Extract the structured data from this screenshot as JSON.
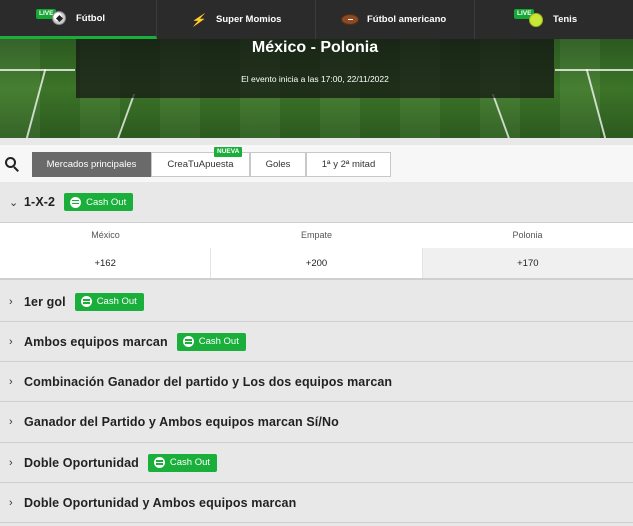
{
  "topnav": {
    "tabs": [
      {
        "label": "Fútbol",
        "live": "LIVE",
        "icon": "soccer-ball-icon"
      },
      {
        "label": "Super Momios",
        "icon": "super-momios-icon"
      },
      {
        "label": "Fútbol americano",
        "icon": "american-football-icon"
      },
      {
        "label": "Tenis",
        "live": "LIVE",
        "icon": "tennis-ball-icon"
      }
    ]
  },
  "event": {
    "title": "México - Polonia",
    "start": "El evento inicia a las 17:00, 22/11/2022"
  },
  "market_tabs": [
    {
      "label": "Mercados principales",
      "active": true
    },
    {
      "label": "CreaTuApuesta",
      "badge": "NUEVA"
    },
    {
      "label": "Goles"
    },
    {
      "label": "1ª y 2ª mitad"
    }
  ],
  "cashout_label": "Cash Out",
  "markets": [
    {
      "title": "1-X-2",
      "cashout": true,
      "expanded": true
    },
    {
      "title": "1er gol",
      "cashout": true
    },
    {
      "title": "Ambos equipos marcan",
      "cashout": true
    },
    {
      "title": "Combinación Ganador del partido y Los dos equipos marcan",
      "cashout": false
    },
    {
      "title": "Ganador del Partido y Ambos equipos marcan Sí/No",
      "cashout": false
    },
    {
      "title": "Doble Oportunidad",
      "cashout": true
    },
    {
      "title": "Doble Oportunidad y Ambos equipos marcan",
      "cashout": false
    }
  ],
  "outcomes": {
    "headers": [
      "México",
      "Empate",
      "Polonia"
    ],
    "odds": [
      "+162",
      "+200",
      "+170"
    ]
  },
  "colors": {
    "accent": "#1aaf3a",
    "nav_bg": "#2b2b2b"
  }
}
